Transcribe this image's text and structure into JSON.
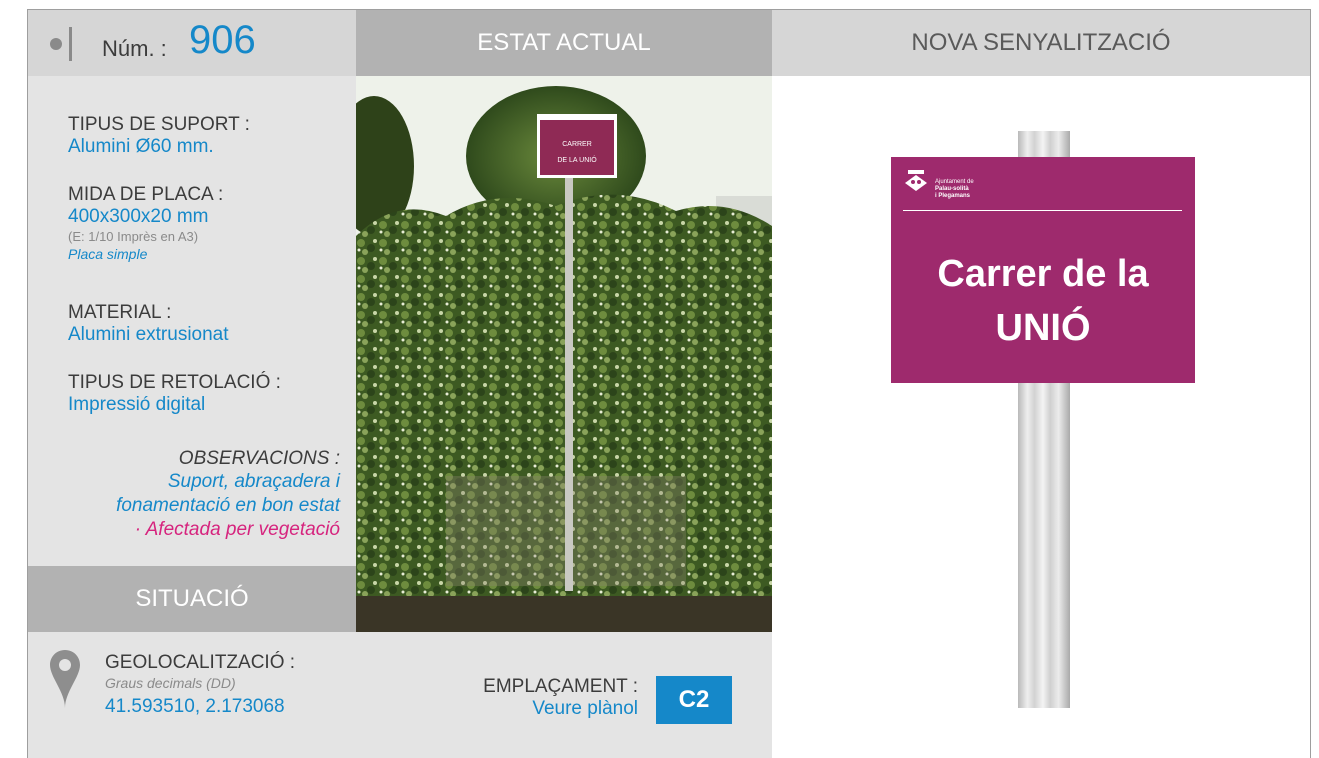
{
  "header": {
    "num_label": "Núm. :",
    "num_value": "906",
    "estat_actual": "ESTAT ACTUAL",
    "nova_senyalitzacio": "NOVA SENYALITZACIÓ"
  },
  "info": {
    "suport_label": "TIPUS DE SUPORT :",
    "suport_value": "Alumini Ø60 mm.",
    "mida_label": "MIDA DE PLACA :",
    "mida_value": "400x300x20 mm",
    "mida_scale": "(E: 1/10 Imprès en A3)",
    "mida_type": "Placa simple",
    "material_label": "MATERIAL :",
    "material_value": "Alumini extrusionat",
    "retolacio_label": "TIPUS DE RETOLACIÓ :",
    "retolacio_value": "Impressió digital",
    "obs_label": "OBSERVACIONS :",
    "obs_line1": "Suport, abraçadera i",
    "obs_line2": "fonamentació en bon estat",
    "obs_line3": "· Afectada per vegetació"
  },
  "situacio": "SITUACIÓ",
  "location": {
    "geo_label": "GEOLOCALITZACIÓ :",
    "geo_format": "Graus decimals (DD)",
    "geo_value": "41.593510, 2.173068",
    "empl_label": "EMPLAÇAMENT :",
    "empl_value": "Veure plànol",
    "empl_code": "C2"
  },
  "photo": {
    "sign_line1": "CARRER",
    "sign_line2": "DE LA UNIÓ"
  },
  "new_sign": {
    "ajuntament_line1": "Ajuntament de",
    "ajuntament_line2": "Palau-solità",
    "ajuntament_line3": "i Plegamans",
    "street_line1": "Carrer de la",
    "street_line2": "UNIÓ",
    "color": "#9e2a6d"
  },
  "colors": {
    "accent": "#1588c9",
    "warning": "#d6247e"
  }
}
